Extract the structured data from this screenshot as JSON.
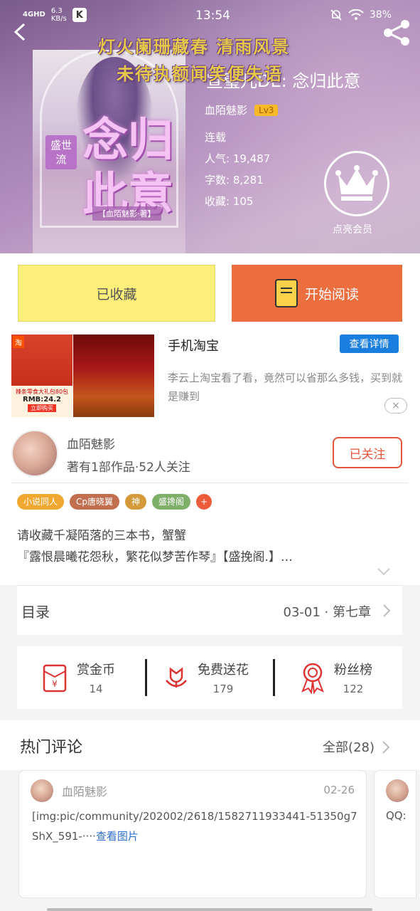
{
  "status_bar": {
    "network": "4GHD",
    "speed": "6.3\nKB/s",
    "app_badge": "K",
    "time": "13:54",
    "battery": "38%"
  },
  "banner": {
    "line1": "灯火阑珊藏春 清雨风景",
    "line2": "未待执额闻笑便失语"
  },
  "cover": {
    "title": "念归此意",
    "vertical_label": "盛世流",
    "subtitle": "【血陌魅影·著】"
  },
  "book": {
    "title": "宣璧儿DE: 念归此意",
    "author": "血陌魅影",
    "level": "Lv3",
    "status": "连载",
    "popularity": "人气: 19,487",
    "word_count": "字数: 8,281",
    "favorites": "收藏: 105",
    "vip_label": "点亮会员"
  },
  "actions": {
    "collected": "已收藏",
    "start_reading": "开始阅读"
  },
  "ad": {
    "tag": "淘",
    "promo": "辣条零食大礼包80包",
    "price": "RMB:24.2",
    "buy": "立即购买",
    "title": "手机淘宝",
    "detail_button": "查看详情",
    "description": "李云上淘宝看了看，竟然可以省那么多钱，买到就是赚到",
    "close": "×"
  },
  "author_section": {
    "name": "血陌魅影",
    "stats": "著有1部作品·52人关注",
    "follow": "已关注",
    "tags": [
      "小说同人",
      "Cp唐晓翼",
      "神",
      "盛搀阁",
      "+"
    ],
    "description": "请收藏千凝陌落的三本书，蟹蟹\n『露恨晨曦花怨秋，繁花似梦苦作琴』【盛挽阁.】…"
  },
  "toc": {
    "label": "目录",
    "latest": "03-01 · 第七章"
  },
  "stats": {
    "reward": {
      "label": "赏金币",
      "value": "14"
    },
    "flowers": {
      "label": "免费送花",
      "value": "179"
    },
    "fans": {
      "label": "粉丝榜",
      "value": "122"
    }
  },
  "comments": {
    "title": "热门评论",
    "all": "全部(28)",
    "items": [
      {
        "name": "血陌魅影",
        "date": "02-26",
        "text": "[img:pic/community/202002/2618/1582711933441-51350g7ShX_591-····",
        "link": "查看图片"
      },
      {
        "text": "QQ:"
      }
    ]
  },
  "colors": {
    "accent_orange": "#ec6d3d",
    "fav_yellow": "#fcee7a",
    "link_blue": "#1a7ede"
  }
}
